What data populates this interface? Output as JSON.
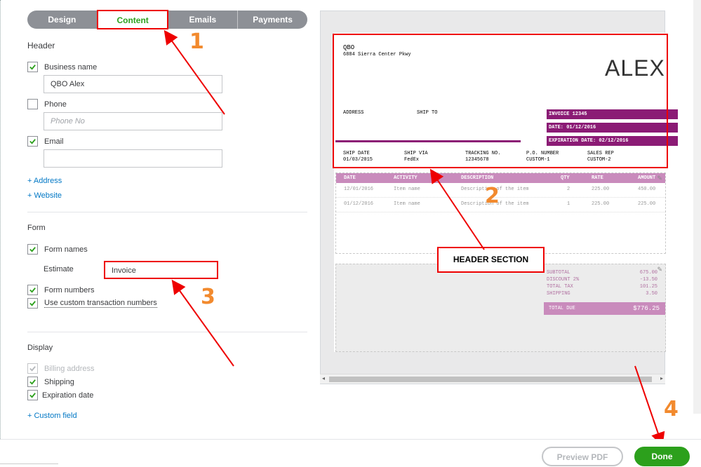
{
  "tabs": [
    {
      "label": "Design"
    },
    {
      "label": "Content"
    },
    {
      "label": "Emails"
    },
    {
      "label": "Payments"
    }
  ],
  "header_section": {
    "title": "Header",
    "business_name_label": "Business name",
    "business_name_value": "QBO Alex",
    "phone_label": "Phone",
    "phone_placeholder": "Phone No",
    "email_label": "Email",
    "email_value": "",
    "add_address": "+ Address",
    "add_website": "+ Website"
  },
  "form_section": {
    "title": "Form",
    "form_names_label": "Form names",
    "estimate_label": "Estimate",
    "estimate_value": "Invoice",
    "form_numbers_label": "Form numbers",
    "custom_txn_label": "Use custom transaction numbers"
  },
  "display_section": {
    "title": "Display",
    "billing_address_label": "Billing address",
    "shipping_label": "Shipping",
    "expiration_label": "Expiration date",
    "custom_field_link": "+ Custom field"
  },
  "invoice": {
    "company": "QBO",
    "street": "6884 Sierra Center Pkwy",
    "logo": "ALEX",
    "address_label": "ADDRESS",
    "ship_to_label": "SHIP TO",
    "invoice_no": "INVOICE 12345",
    "date": "DATE: 01/12/2016",
    "expiration": "EXPIRATION DATE: 02/12/2016",
    "ship_cols": [
      "SHIP DATE",
      "SHIP VIA",
      "TRACKING NO.",
      "P.O. NUMBER",
      "SALES REP"
    ],
    "ship_vals": [
      "01/03/2015",
      "FedEx",
      "12345678",
      "CUSTOM-1",
      "CUSTOM-2"
    ],
    "table_headers": [
      "DATE",
      "ACTIVITY",
      "DESCRIPTION",
      "QTY",
      "RATE",
      "AMOUNT"
    ],
    "rows": [
      [
        "12/01/2016",
        "Item name",
        "Description of the item",
        "2",
        "225.00",
        "450.00"
      ],
      [
        "01/12/2016",
        "Item name",
        "Description of the item",
        "1",
        "225.00",
        "225.00"
      ]
    ],
    "totals_labels": [
      "SUBTOTAL",
      "DISCOUNT 2%",
      "TOTAL TAX",
      "SHIPPING"
    ],
    "totals_values": [
      "675.00",
      "-13.50",
      "101.25",
      "3.50"
    ],
    "total_due_label": "TOTAL DUE",
    "total_due_value": "$776.25"
  },
  "annotations": {
    "n1": "1",
    "n2": "2",
    "n3": "3",
    "n4": "4",
    "header_section_callout": "HEADER SECTION",
    "color": "#e00000"
  },
  "footer": {
    "preview_pdf": "Preview PDF",
    "done": "Done"
  },
  "colors": {
    "accent_green": "#2ca01c",
    "invoice_purple": "#8b1b75",
    "table_header": "#c98bbc",
    "link_blue": "#0077c5"
  }
}
